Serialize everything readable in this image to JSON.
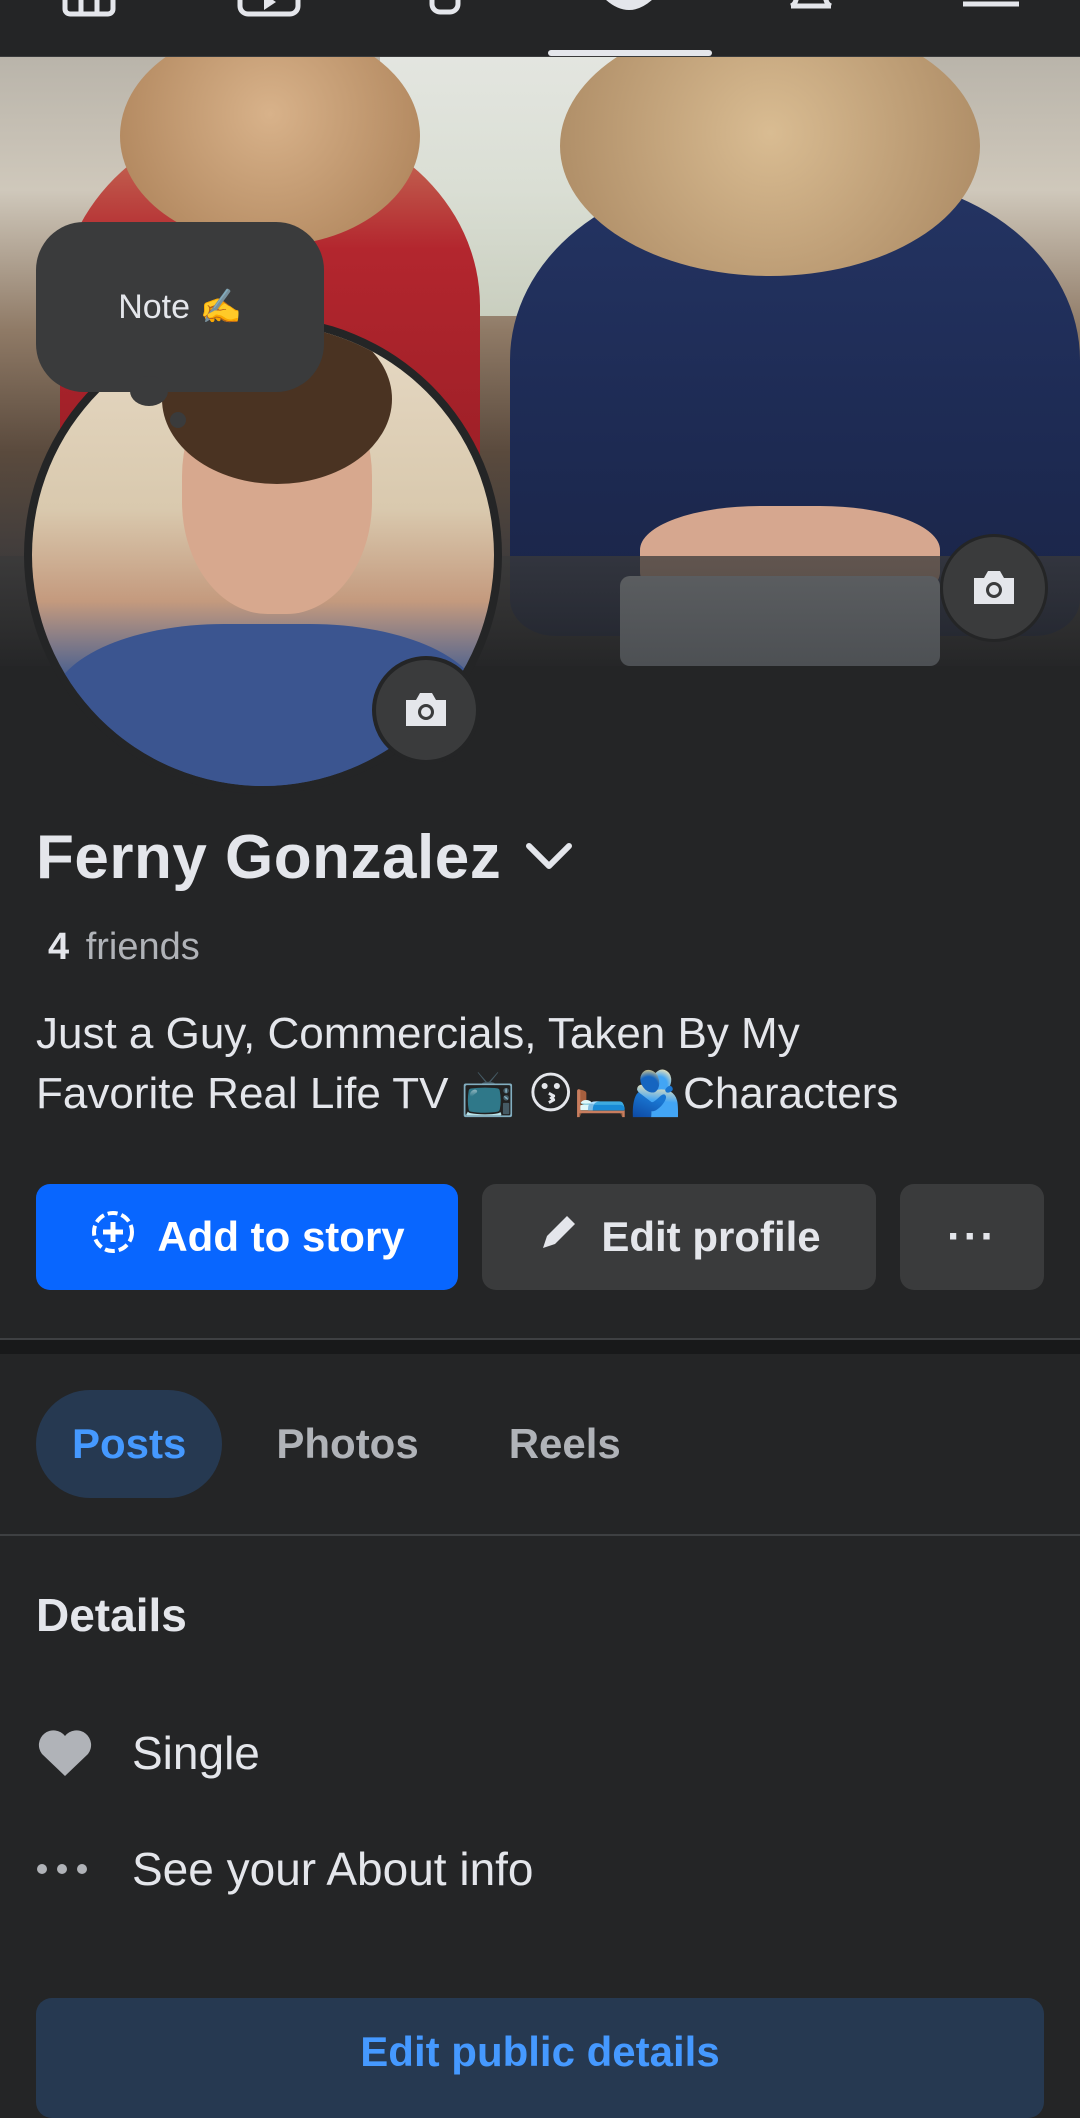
{
  "nav": {
    "items": [
      "home",
      "video",
      "friends",
      "profile",
      "notifications",
      "menu"
    ],
    "active": "profile"
  },
  "note": {
    "label": "Note ✍️"
  },
  "profile": {
    "name": "Ferny Gonzalez",
    "friends_count": "4",
    "friends_label": "friends",
    "bio_line1": "Just a Guy, Commercials, Taken By My",
    "bio_line2": "Favorite Real Life TV 📺 😗🛏️🫂Characters"
  },
  "actions": {
    "add_story": "Add to story",
    "edit_profile": "Edit profile",
    "more": "···"
  },
  "tabs": [
    {
      "label": "Posts",
      "active": true
    },
    {
      "label": "Photos",
      "active": false
    },
    {
      "label": "Reels",
      "active": false
    }
  ],
  "details": {
    "title": "Details",
    "relationship": "Single",
    "about": "See your About info",
    "edit_public": "Edit public details"
  },
  "colors": {
    "accent": "#0866ff",
    "accent_soft": "#263951",
    "link": "#4599ff",
    "background": "#242526"
  }
}
